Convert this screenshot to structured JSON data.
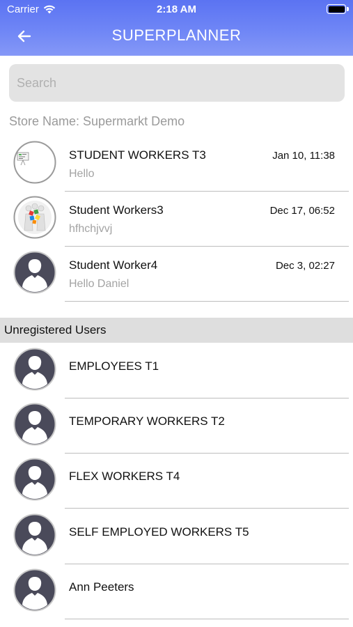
{
  "status_bar": {
    "carrier": "Carrier",
    "time": "2:18 AM"
  },
  "nav": {
    "title": "SUPERPLANNER"
  },
  "search": {
    "placeholder": "Search"
  },
  "store_label": "Store Name: Supermarkt Demo",
  "chats": [
    {
      "name": "STUDENT WORKERS T3",
      "message": "Hello",
      "date": "Jan 10, 11:38",
      "avatar": "whiteboard-thumbnail"
    },
    {
      "name": "Student Workers3",
      "message": "hfhchjvvj",
      "date": "Dec 17, 06:52",
      "avatar": "puzzle-people-thumbnail"
    },
    {
      "name": "Student Worker4",
      "message": "Hello Daniel",
      "date": "Dec 3, 02:27",
      "avatar": "person-icon"
    }
  ],
  "unregistered": {
    "header": "Unregistered Users",
    "users": [
      {
        "name": "EMPLOYEES T1",
        "avatar": "person-icon"
      },
      {
        "name": "TEMPORARY WORKERS T2",
        "avatar": "person-icon"
      },
      {
        "name": "FLEX WORKERS T4",
        "avatar": "person-icon"
      },
      {
        "name": "SELF EMPLOYED WORKERS T5",
        "avatar": "person-icon"
      },
      {
        "name": "Ann Peeters",
        "avatar": "person-icon"
      }
    ]
  },
  "colors": {
    "header_gradient_top": "#5b73f2",
    "header_gradient_bottom": "#8598f7",
    "section_header_bg": "#dedede",
    "avatar_dark": "#4a4a5a"
  }
}
